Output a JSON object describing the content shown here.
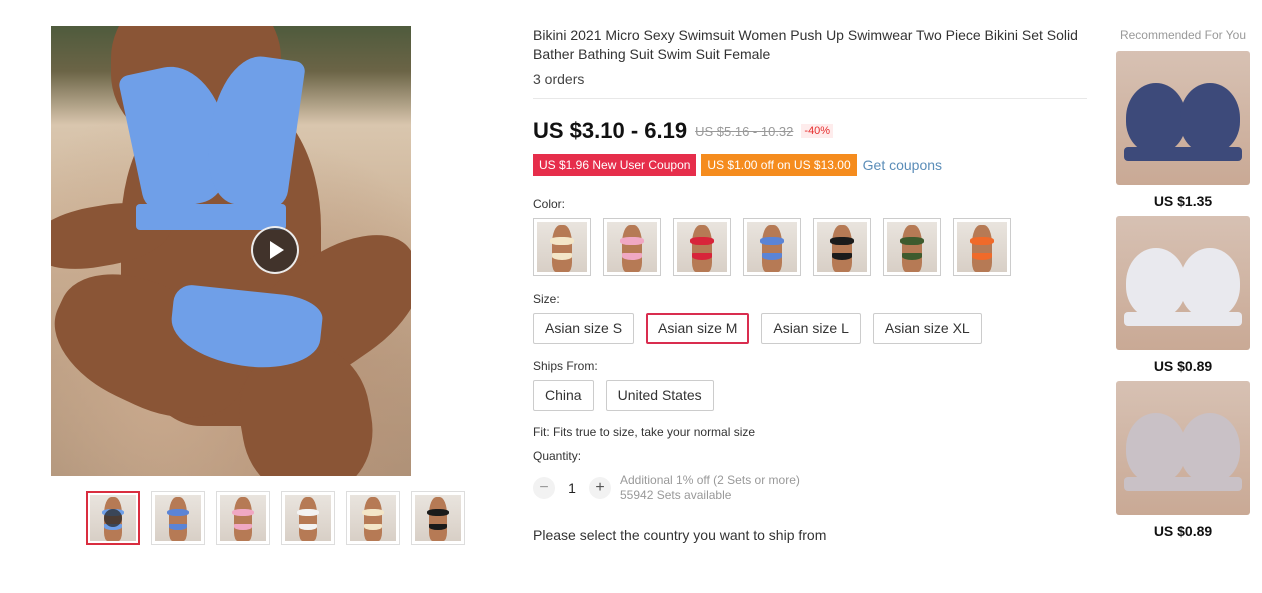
{
  "product": {
    "title": "Bikini 2021 Micro Sexy Swimsuit Women Push Up Swimwear Two Piece Bikini Set Solid Bather Bathing Suit Swim Suit Female",
    "orders": "3 orders",
    "price": "US $3.10 - 6.19",
    "old_price": "US $5.16 - 10.32",
    "discount": "-40%"
  },
  "coupons": {
    "new_user": "US $1.96 New User Coupon",
    "store": "US $1.00 off on US $13.00",
    "get_link": "Get coupons"
  },
  "color": {
    "label": "Color:",
    "swatches": [
      "#f3e6c8",
      "#f0a8c4",
      "#d8243a",
      "#5b84d6",
      "#1b1b1b",
      "#3e5b2e",
      "#f06a2a"
    ]
  },
  "size": {
    "label": "Size:",
    "options": [
      "Asian size S",
      "Asian size M",
      "Asian size L",
      "Asian size XL"
    ],
    "selected": "Asian size M"
  },
  "ships": {
    "label": "Ships From:",
    "options": [
      "China",
      "United States"
    ]
  },
  "fit": "Fit: Fits true to size, take your normal size",
  "quantity": {
    "label": "Quantity:",
    "value": "1",
    "minus": "−",
    "plus": "+",
    "note1": "Additional 1% off (2 Sets or more)",
    "note2": "55942 Sets available"
  },
  "ship_message": "Please select the country you want to ship from",
  "recommended": {
    "title": "Recommended For You",
    "items": [
      {
        "price": "US $1.35",
        "color": "#3d4a7a"
      },
      {
        "price": "US $0.89",
        "color": "#e9e9ee"
      },
      {
        "price": "US $0.89",
        "color": "#c9c1c6"
      }
    ]
  },
  "thumbnails": [
    "#6f9fe8",
    "#5b84d6",
    "#f0a8c4",
    "#f3f3f3",
    "#f3e6c8",
    "#1b1b1b"
  ]
}
